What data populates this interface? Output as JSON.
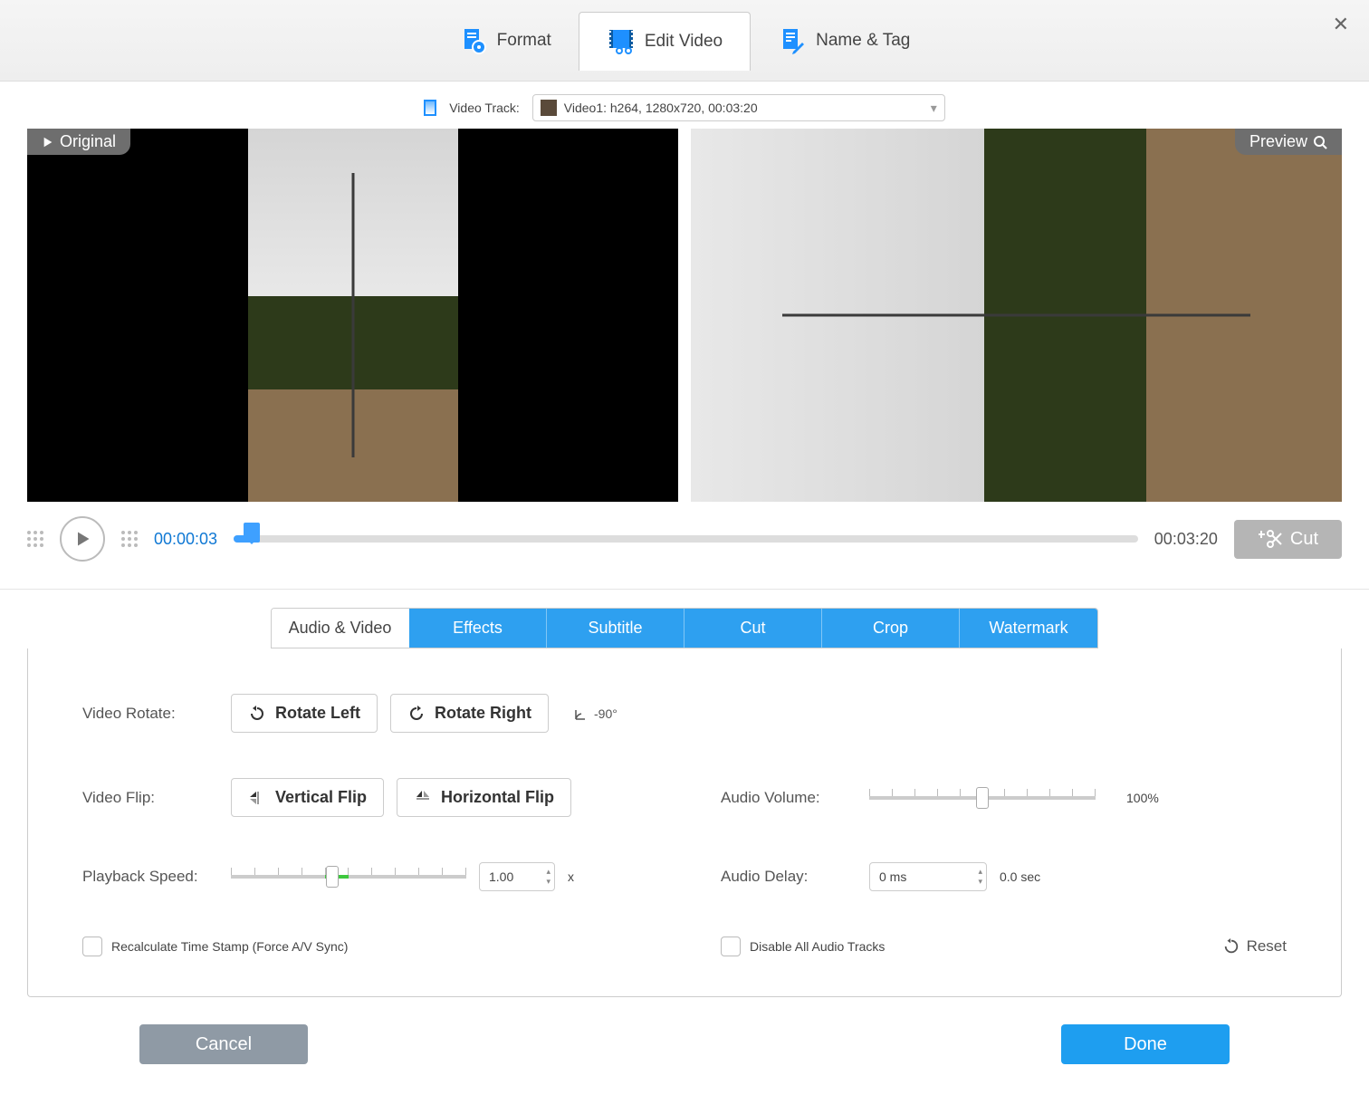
{
  "top_tabs": {
    "format": "Format",
    "edit_video": "Edit Video",
    "name_tag": "Name & Tag"
  },
  "track": {
    "label": "Video Track:",
    "value": "Video1: h264, 1280x720, 00:03:20"
  },
  "panes": {
    "original": "Original",
    "preview": "Preview"
  },
  "playback": {
    "current": "00:00:03",
    "duration": "00:03:20",
    "cut": "Cut"
  },
  "sub_tabs": {
    "audio_video": "Audio & Video",
    "effects": "Effects",
    "subtitle": "Subtitle",
    "cut": "Cut",
    "crop": "Crop",
    "watermark": "Watermark"
  },
  "controls": {
    "rotate_label": "Video Rotate:",
    "rotate_left": "Rotate Left",
    "rotate_right": "Rotate Right",
    "rotate_value": "-90°",
    "flip_label": "Video Flip:",
    "vertical_flip": "Vertical Flip",
    "horizontal_flip": "Horizontal Flip",
    "speed_label": "Playback Speed:",
    "speed_value": "1.00",
    "speed_suffix": "x",
    "volume_label": "Audio Volume:",
    "volume_value": "100%",
    "delay_label": "Audio Delay:",
    "delay_value": "0 ms",
    "delay_seconds": "0.0 sec",
    "recalc": "Recalculate Time Stamp (Force A/V Sync)",
    "disable_audio": "Disable All Audio Tracks",
    "reset": "Reset"
  },
  "footer": {
    "cancel": "Cancel",
    "done": "Done"
  }
}
